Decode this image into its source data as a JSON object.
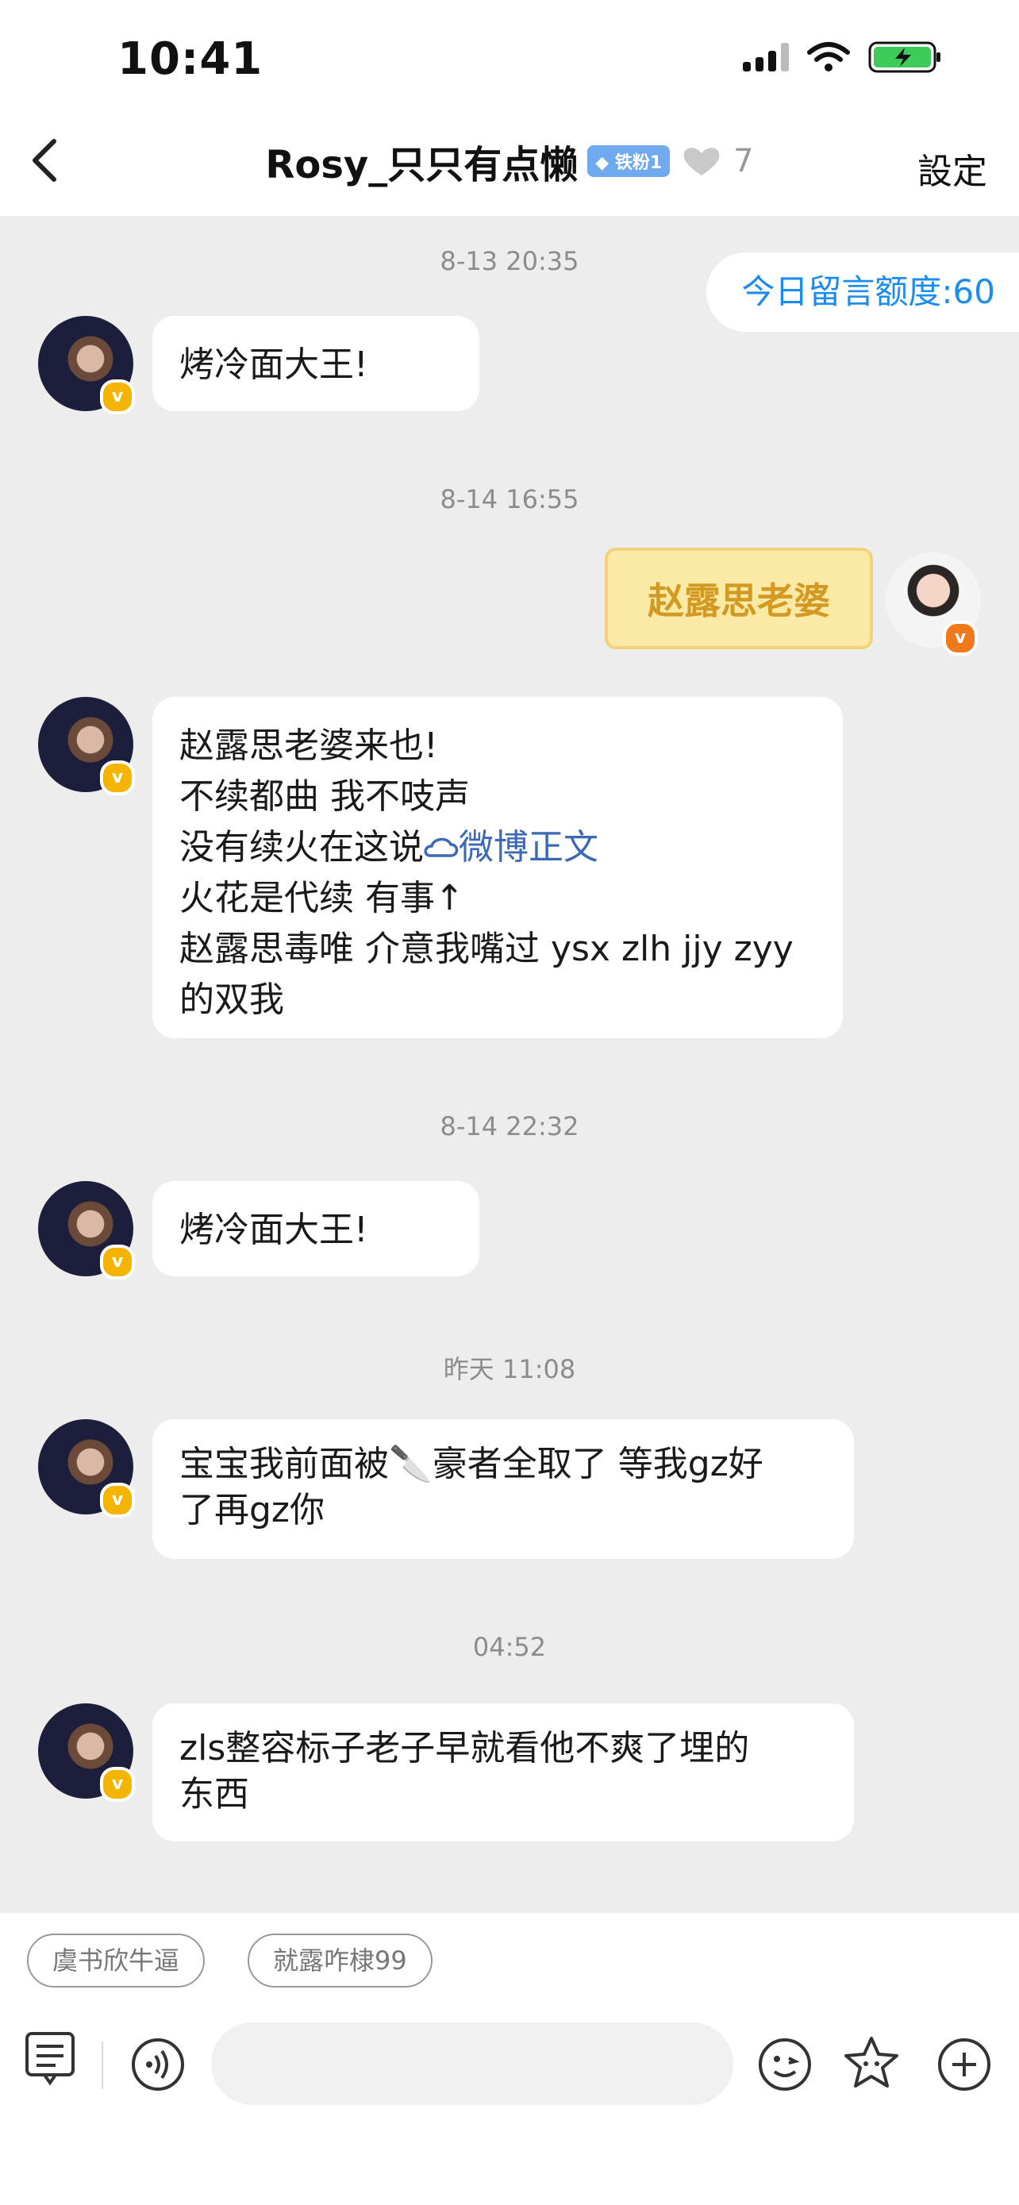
{
  "status_bar": {
    "time": "10:41"
  },
  "nav": {
    "title": "Rosy_只只有点懒",
    "fan_badge": "铁粉1",
    "heart_count": "7",
    "settings": "設定"
  },
  "quota": "今日留言额度:60",
  "timestamps": [
    "8-13 20:35",
    "8-14 16:55",
    "8-14 22:32",
    "昨天 11:08",
    "04:52"
  ],
  "messages": {
    "m1": "烤冷面大王!",
    "sticker": "赵露思老婆",
    "m2_lines": [
      "赵露思老婆来也!",
      "不续都曲 我不吱声",
      "没有续火在这说",
      "火花是代续 有事↑",
      "赵露思毒唯 介意我嘴过 ysx zlh jjy zyy",
      "的双我"
    ],
    "m2_link": "微博正文",
    "m3": "烤冷面大王!",
    "m4_line1": "宝宝我前面被🔪豪者全取了 等我gz好",
    "m4_line2": "了再gz你",
    "m5_line1": "zls整容标子老子早就看他不爽了埋的",
    "m5_line2": "东西"
  },
  "quick_replies": [
    "虞书欣牛逼",
    "就露咋棣99"
  ],
  "colors": {
    "accent": "#1d8cf0",
    "link": "#3b69b5",
    "badge": "#f4b400",
    "orange_badge": "#f07a1a"
  }
}
